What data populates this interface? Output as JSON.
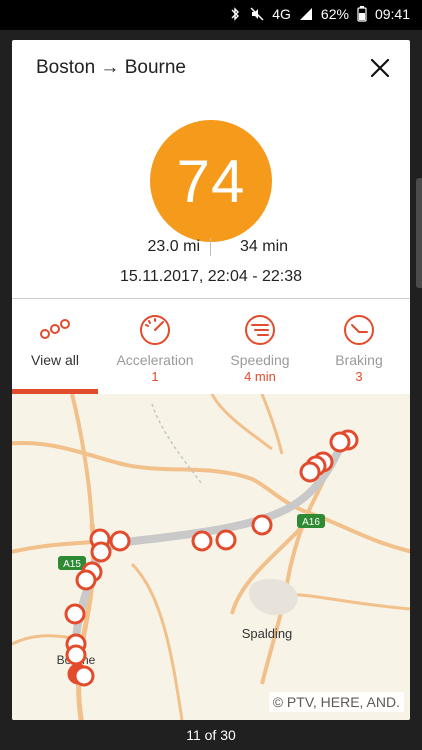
{
  "status": {
    "network": "4G",
    "battery": "62%",
    "time": "09:41"
  },
  "card": {
    "title": "Boston → Bourne",
    "score": "74",
    "distance": "23.0 mi",
    "duration": "34 min",
    "datetime": "15.11.2017, 22:04 - 22:38"
  },
  "tabs": [
    {
      "label": "View all",
      "sub": ""
    },
    {
      "label": "Acceleration",
      "sub": "1"
    },
    {
      "label": "Speeding",
      "sub": "4 min"
    },
    {
      "label": "Braking",
      "sub": "3"
    }
  ],
  "map": {
    "roads": [
      "A16",
      "A15"
    ],
    "places": [
      "Spalding",
      "Bourne"
    ],
    "credit": "© PTV, HERE, AND."
  },
  "pager": "11 of 30",
  "colors": {
    "accent": "#e24b2c",
    "score_bg": "#f59a1a"
  }
}
